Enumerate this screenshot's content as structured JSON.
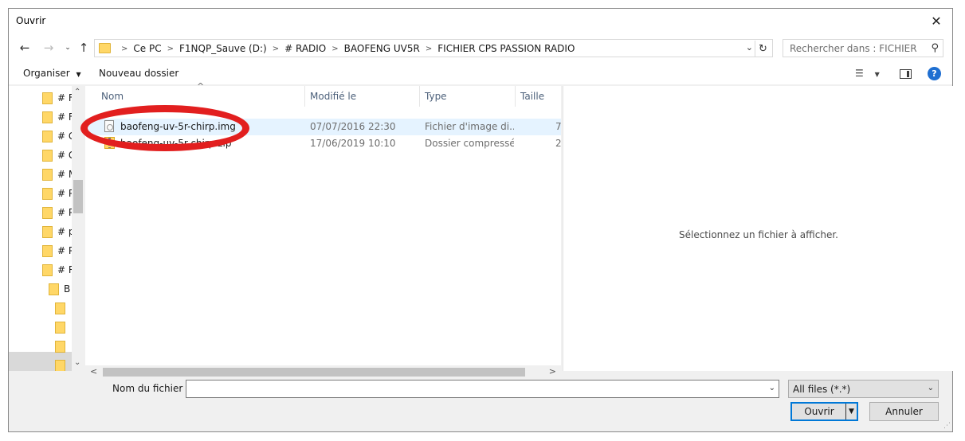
{
  "window": {
    "title": "Ouvrir"
  },
  "address": {
    "crumbs": [
      "Ce PC",
      "F1NQP_Sauve (D:)",
      "# RADIO",
      "BAOFENG UV5R",
      "FICHIER CPS PASSION RADIO"
    ],
    "search_placeholder": "Rechercher dans : FICHIER CP..."
  },
  "toolbar": {
    "organize_label": "Organiser",
    "new_folder_label": "Nouveau dossier"
  },
  "nav_pane": {
    "items": [
      "# F",
      "# F",
      "# G",
      "# G",
      "# M",
      "# P",
      "# P",
      "# p",
      "# P",
      "# R",
      "B",
      "",
      "",
      "",
      ""
    ]
  },
  "file_list": {
    "columns": [
      "Nom",
      "Modifié le",
      "Type",
      "Taille"
    ],
    "rows": [
      {
        "name": "baofeng-uv-5r-chirp.img",
        "modified": "07/07/2016 22:30",
        "type": "Fichier d'image di...",
        "size": "7",
        "icon": "image-file-icon",
        "selected": true
      },
      {
        "name": "baofeng-uv-5r-chirp.zip",
        "modified": "17/06/2019 10:10",
        "type": "Dossier compressé",
        "size": "2",
        "icon": "zip-folder-icon",
        "selected": false
      }
    ]
  },
  "preview": {
    "empty_text": "Sélectionnez un fichier à afficher."
  },
  "footer": {
    "filename_label": "Nom du fichier :",
    "filename_value": "",
    "filetype_value": "All files (*.*)",
    "open_label": "Ouvrir",
    "cancel_label": "Annuler"
  },
  "colors": {
    "accent": "#0078d7",
    "highlight": "#e21f1f",
    "selection": "#e5f3ff",
    "folder": "#ffd767"
  }
}
